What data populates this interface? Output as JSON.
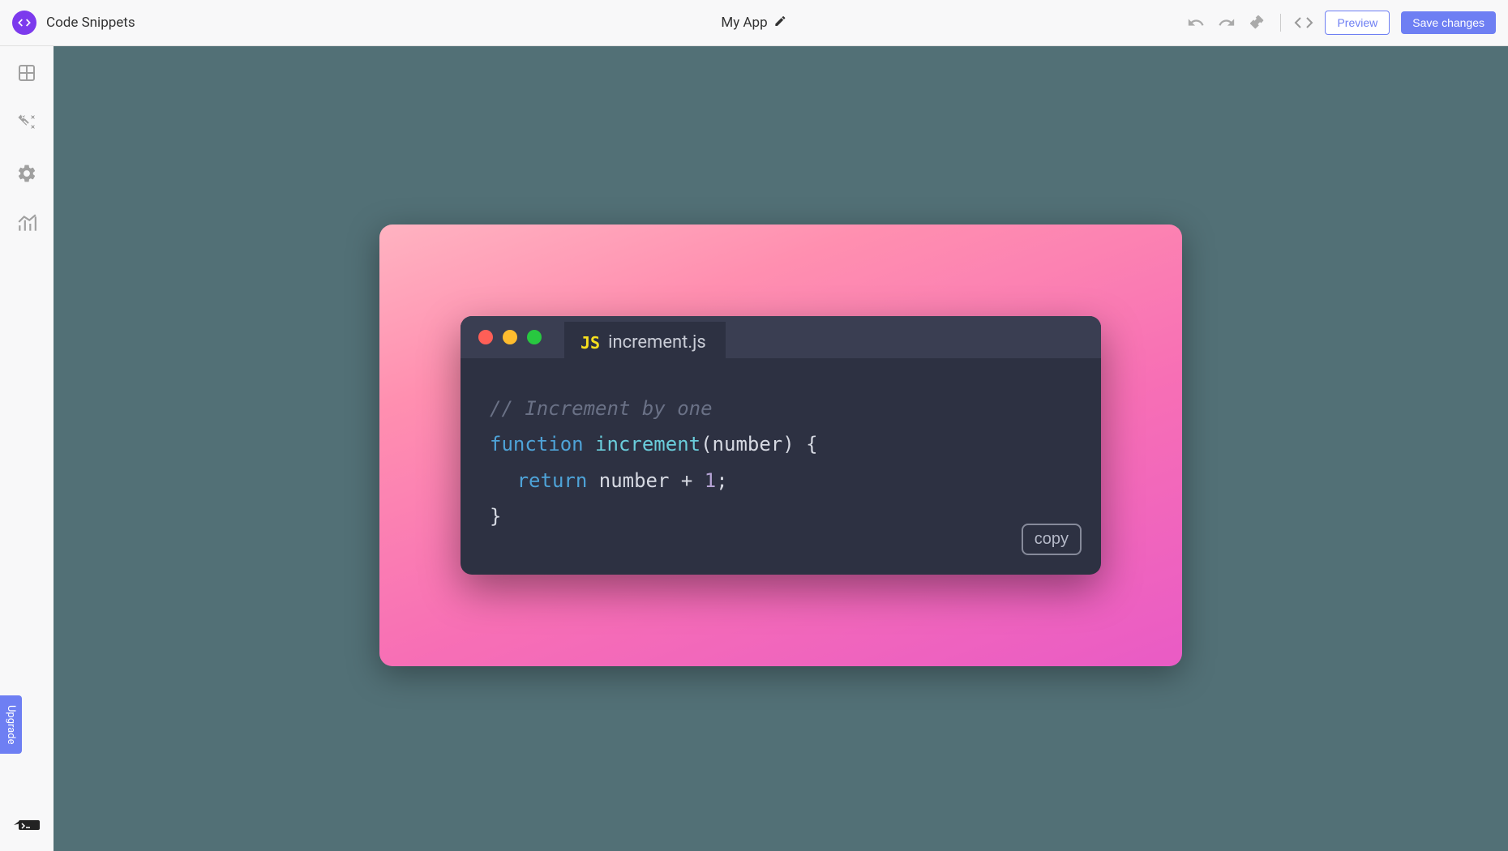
{
  "header": {
    "page_title": "Code Snippets",
    "app_name": "My App",
    "preview_label": "Preview",
    "save_label": "Save changes"
  },
  "sidebar": {
    "upgrade_label": "Upgrade"
  },
  "snippet": {
    "file_name": "increment.js",
    "js_badge": "JS",
    "copy_label": "copy",
    "code": {
      "comment": "// Increment by one",
      "kw_function": "function",
      "func_name": "increment",
      "open_paren": "(",
      "param": "number",
      "close_paren": ")",
      "open_brace": " {",
      "kw_return": "return",
      "return_expr_var": " number ",
      "op_plus": "+",
      "space": " ",
      "num_one": "1",
      "semicolon": ";",
      "close_brace": "}"
    }
  }
}
